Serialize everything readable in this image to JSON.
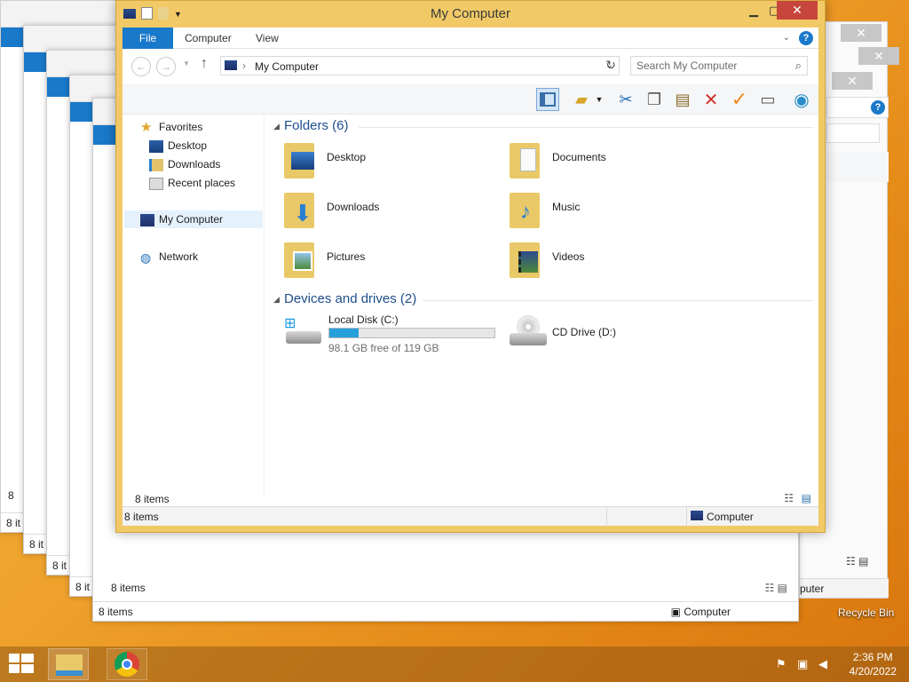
{
  "window": {
    "title": "My Computer",
    "minimize": "▁",
    "maximize": "▢",
    "close": "✕"
  },
  "ribbon": {
    "tabs": [
      "File",
      "Computer",
      "View"
    ],
    "help": "?"
  },
  "address": {
    "back": "←",
    "forward": "→",
    "up": "↑",
    "path": "My Computer",
    "separator": "›",
    "refresh": "↻",
    "search_placeholder": "Search My Computer"
  },
  "nav": {
    "favorites": "Favorites",
    "desktop": "Desktop",
    "downloads": "Downloads",
    "recent": "Recent places",
    "computer": "My Computer",
    "network": "Network"
  },
  "content": {
    "folders_header": "Folders (6)",
    "folders": [
      "Desktop",
      "Documents",
      "Downloads",
      "Music",
      "Pictures",
      "Videos"
    ],
    "drives_header": "Devices and drives (2)",
    "drive_c": {
      "name": "Local Disk (C:)",
      "free": "98.1 GB free of 119 GB",
      "used_fraction": 0.18
    },
    "drive_d": {
      "name": "CD Drive (D:)"
    }
  },
  "status": {
    "items_inner": "8 items",
    "items": "8 items",
    "location": "Computer"
  },
  "background": {
    "items1": "8 it",
    "items2": "8 it",
    "items3": "8 it",
    "items4": "8 it",
    "items5": "8 items",
    "items6": "8 items",
    "location": "Computer",
    "location_right": "puter",
    "recycle_bin": "Recycle Bin"
  },
  "taskbar": {
    "time": "2:36 PM",
    "date": "4/20/2022"
  },
  "colors": {
    "accent": "#1979ca",
    "window_frame": "#f1c966",
    "close_red": "#c7463b"
  }
}
